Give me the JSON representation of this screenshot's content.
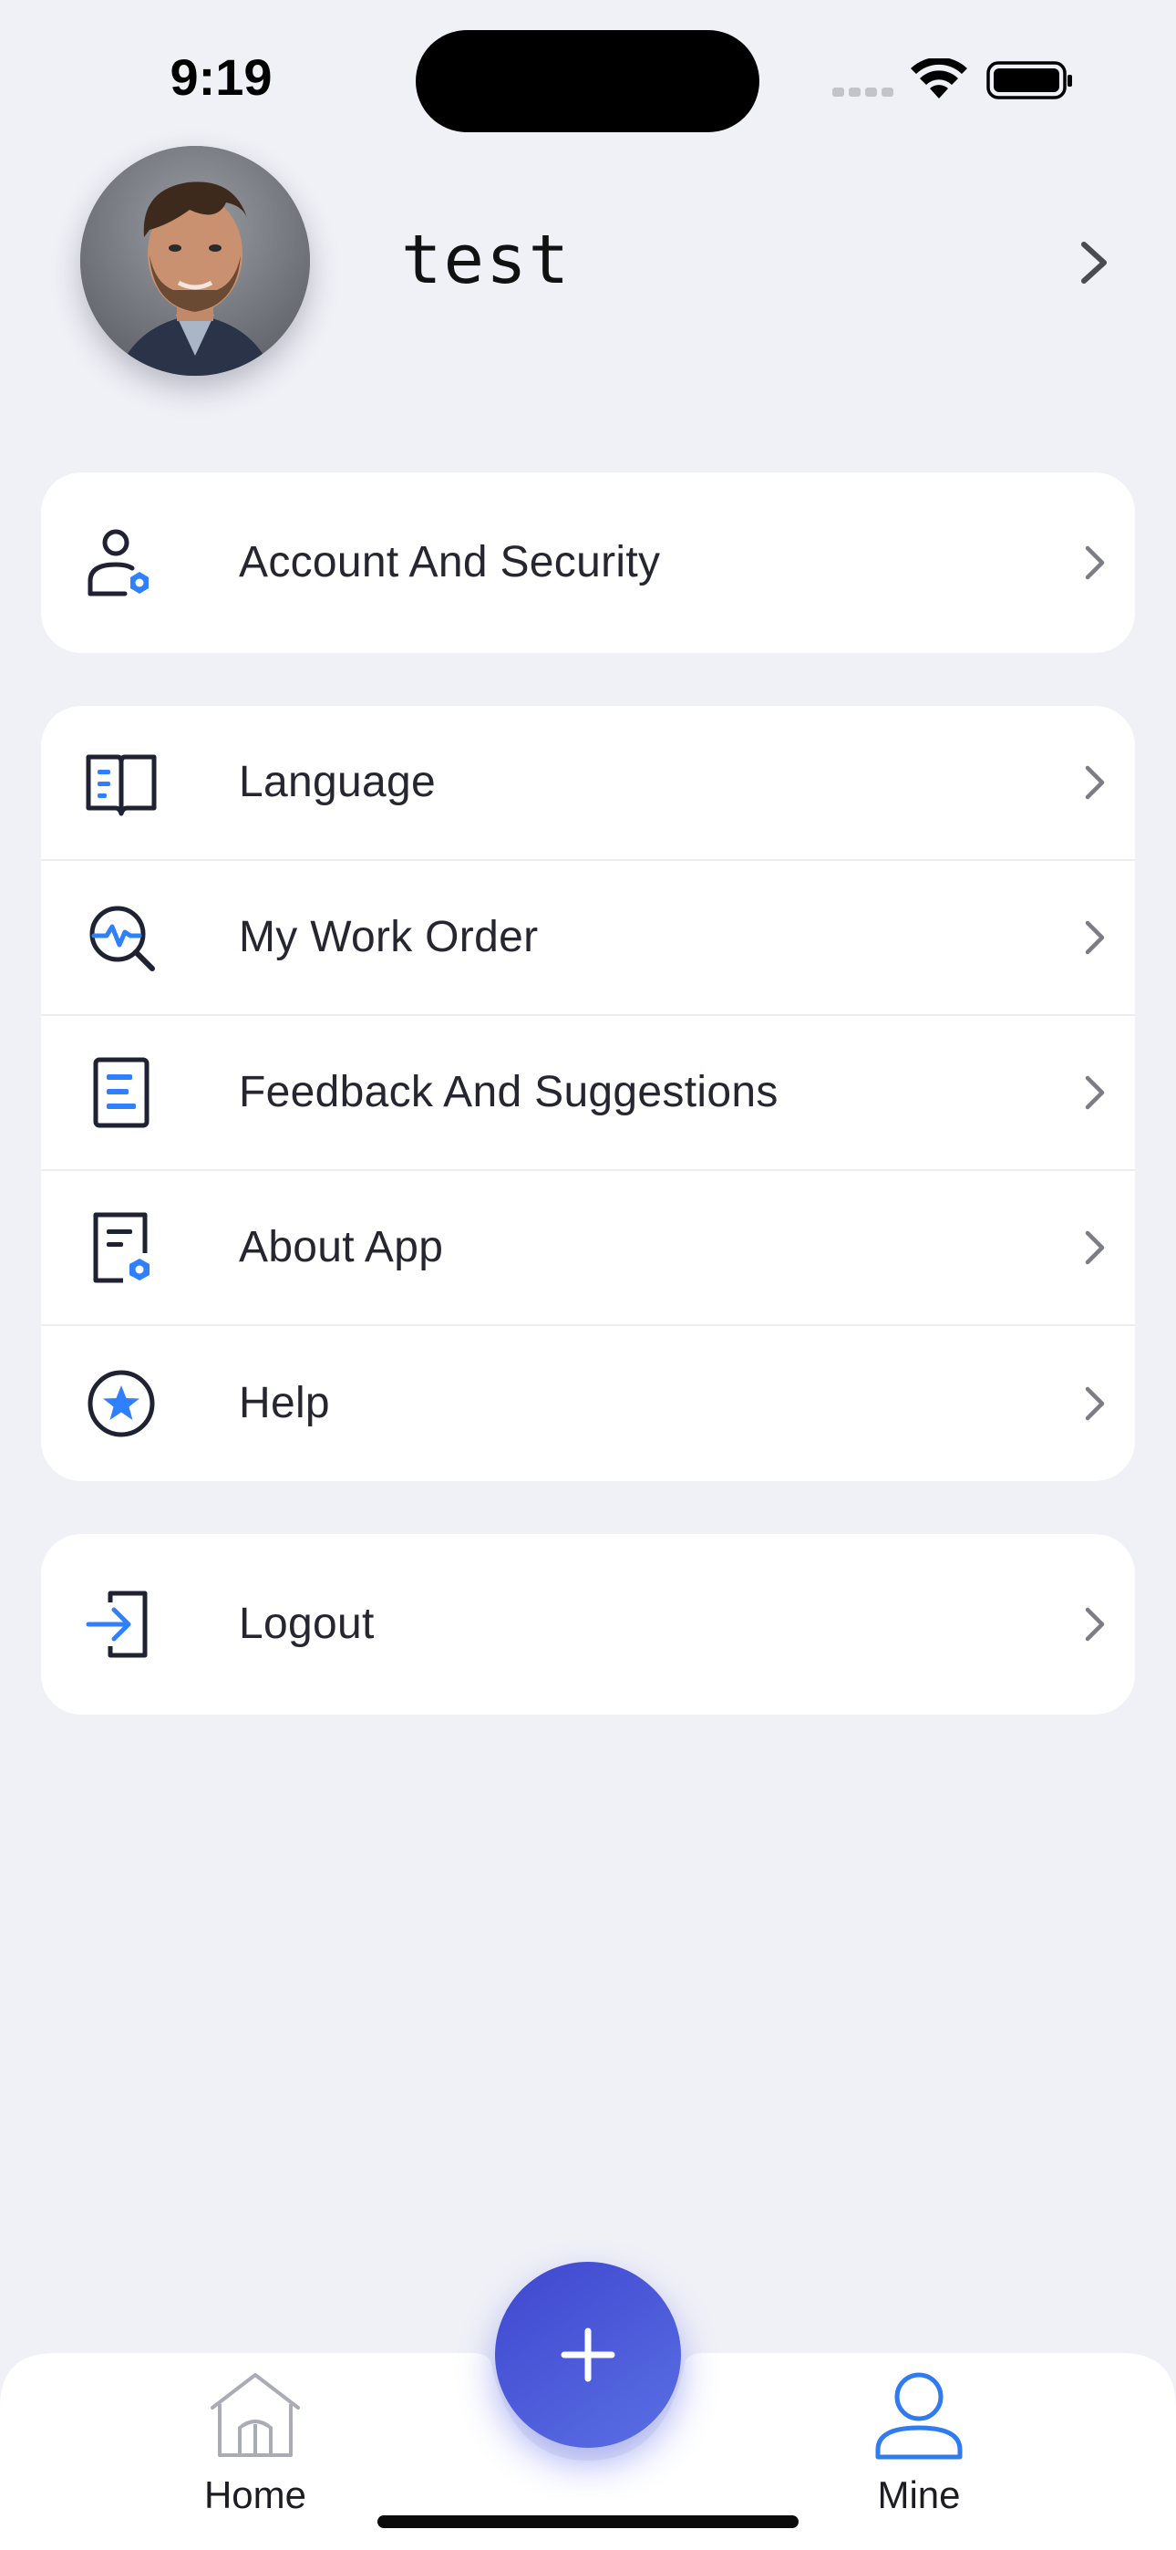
{
  "status_bar": {
    "time": "9:19"
  },
  "profile": {
    "name": "test"
  },
  "menu": {
    "account": {
      "label": "Account And Security",
      "icon": "user-gear-icon"
    },
    "language": {
      "label": "Language",
      "icon": "book-icon"
    },
    "work_order": {
      "label": "My Work Order",
      "icon": "search-pulse-icon"
    },
    "feedback": {
      "label": "Feedback And Suggestions",
      "icon": "document-lines-icon"
    },
    "about": {
      "label": "About App",
      "icon": "document-gear-icon"
    },
    "help": {
      "label": "Help",
      "icon": "star-circle-icon"
    },
    "logout": {
      "label": "Logout",
      "icon": "login-arrow-icon"
    }
  },
  "tab_bar": {
    "home": {
      "label": "Home",
      "active": false
    },
    "mine": {
      "label": "Mine",
      "active": true
    },
    "fab_icon": "plus-icon"
  },
  "colors": {
    "background": "#f0f1f7",
    "accent": "#2f80ff",
    "icon_dark": "#1f2233",
    "fab_start": "#3f47cf",
    "fab_end": "#5a6fe4",
    "active_tab": "#2f7bf0"
  }
}
